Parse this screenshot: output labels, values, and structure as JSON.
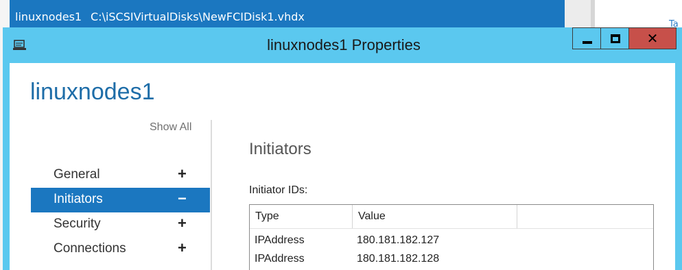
{
  "background": {
    "row_name": "linuxnodes1",
    "row_path": "C:\\iSCSIVirtualDisks\\NewFCIDisk1.vhdx",
    "edge_text": "Ta"
  },
  "dialog": {
    "title": "linuxnodes1 Properties",
    "object_name": "linuxnodes1",
    "window_buttons": {
      "minimize": "minimize",
      "maximize": "maximize",
      "close": "✕"
    }
  },
  "nav": {
    "show_all": "Show All",
    "items": [
      {
        "label": "General",
        "sign": "+",
        "selected": false
      },
      {
        "label": "Initiators",
        "sign": "−",
        "selected": true
      },
      {
        "label": "Security",
        "sign": "+",
        "selected": false
      },
      {
        "label": "Connections",
        "sign": "+",
        "selected": false
      }
    ]
  },
  "section": {
    "title": "Initiators",
    "ids_label": "Initiator IDs:"
  },
  "grid": {
    "columns": [
      "Type",
      "Value",
      ""
    ],
    "rows": [
      {
        "type": "IPAddress",
        "value": "180.181.182.127"
      },
      {
        "type": "IPAddress",
        "value": "180.181.182.128"
      }
    ]
  },
  "colors": {
    "accent": "#1b77c0",
    "titlebar": "#5bc8ef",
    "close_button": "#c7504a",
    "heading": "#1e6da8"
  }
}
